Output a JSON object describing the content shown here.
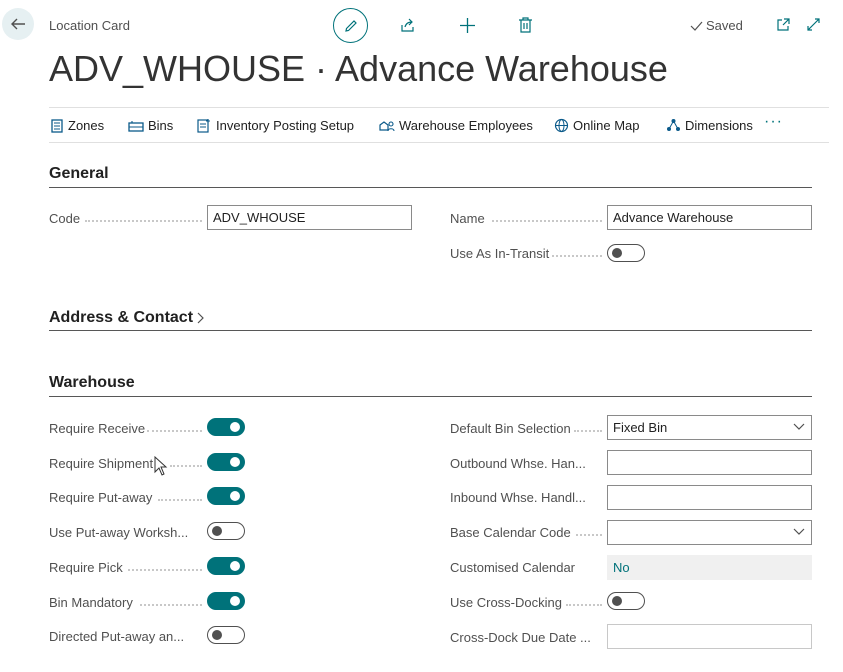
{
  "header": {
    "breadcrumb": "Location Card",
    "title": "ADV_WHOUSE · Advance Warehouse",
    "saved_label": "Saved"
  },
  "actions": [
    {
      "label": "Zones",
      "icon": "zones-icon"
    },
    {
      "label": "Bins",
      "icon": "bins-icon"
    },
    {
      "label": "Inventory Posting Setup",
      "icon": "inventory-posting-setup-icon"
    },
    {
      "label": "Warehouse Employees",
      "icon": "warehouse-employees-icon"
    },
    {
      "label": "Online Map",
      "icon": "globe-icon"
    },
    {
      "label": "Dimensions",
      "icon": "dimensions-icon"
    }
  ],
  "more_label": "···",
  "general": {
    "title": "General",
    "code_label": "Code",
    "code_value": "ADV_WHOUSE",
    "name_label": "Name",
    "name_value": "Advance Warehouse",
    "in_transit_label": "Use As In-Transit",
    "in_transit_on": false
  },
  "address": {
    "title": "Address & Contact"
  },
  "warehouse": {
    "title": "Warehouse",
    "left": [
      {
        "label": "Require Receive",
        "on": true
      },
      {
        "label": "Require Shipment",
        "on": true
      },
      {
        "label": "Require Put-away",
        "on": true
      },
      {
        "label": "Use Put-away Worksh...",
        "on": false
      },
      {
        "label": "Require Pick",
        "on": true
      },
      {
        "label": "Bin Mandatory",
        "on": true
      },
      {
        "label": "Directed Put-away an...",
        "on": false
      }
    ],
    "default_bin_label": "Default Bin Selection",
    "default_bin_value": "Fixed Bin",
    "outbound_label": "Outbound Whse. Han...",
    "outbound_value": "",
    "inbound_label": "Inbound Whse. Handl...",
    "inbound_value": "",
    "base_calendar_label": "Base Calendar Code",
    "base_calendar_value": "",
    "customised_calendar_label": "Customised Calendar",
    "customised_calendar_value": "No",
    "cross_docking_label": "Use Cross-Docking",
    "cross_docking_on": false,
    "cross_dock_due_label": "Cross-Dock Due Date ...",
    "cross_dock_due_value": ""
  },
  "colors": {
    "accent": "#00727a",
    "text": "#212121",
    "label": "#505050"
  }
}
